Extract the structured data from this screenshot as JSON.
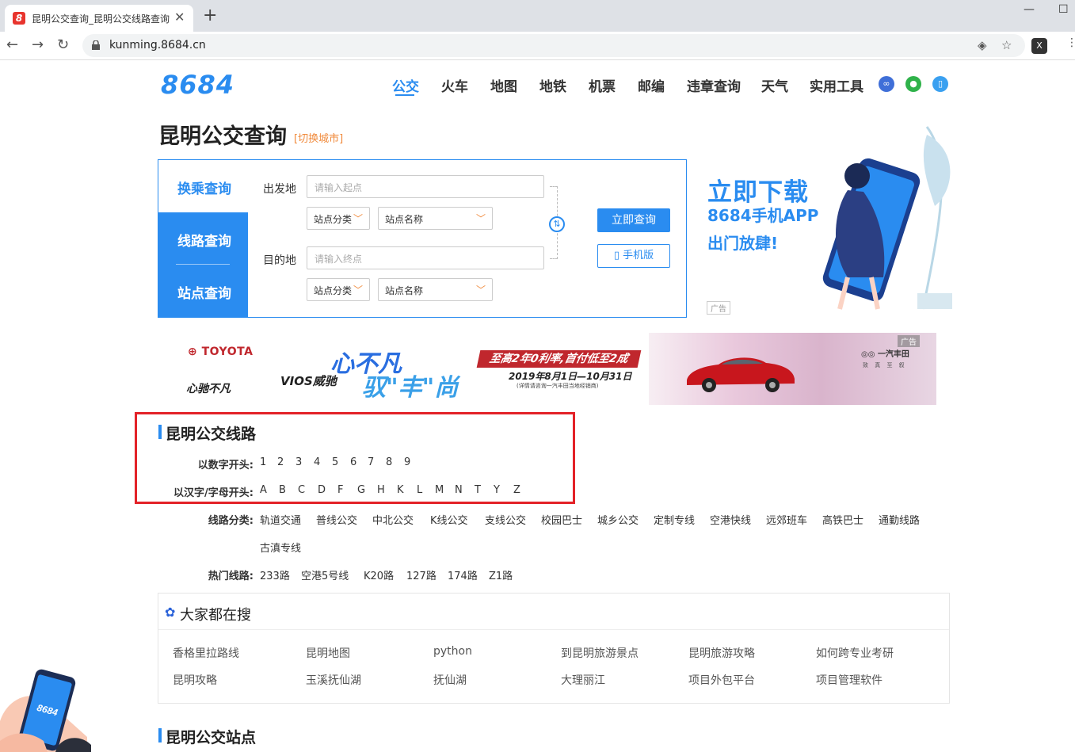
{
  "browser": {
    "tab_title": "昆明公交查询_昆明公交线路查询",
    "tab_favicon": "8",
    "url": "kunming.8684.cn",
    "new_tab": "+",
    "close_tab": "✕"
  },
  "header": {
    "logo": "8684",
    "nav": [
      "公交",
      "火车",
      "地图",
      "地铁",
      "机票",
      "邮编",
      "违章查询",
      "天气",
      "实用工具"
    ],
    "active_nav": "公交",
    "icons": [
      "mini-program-icon",
      "wechat-icon",
      "mobile-icon"
    ]
  },
  "page": {
    "title": "昆明公交查询",
    "switch_city": "[切换城市]"
  },
  "search": {
    "tabs": [
      "换乘查询",
      "线路查询",
      "站点查询"
    ],
    "from_label": "出发地",
    "to_label": "目的地",
    "from_placeholder": "请输入起点",
    "to_placeholder": "请输入终点",
    "station_category": "站点分类",
    "station_name": "站点名称",
    "submit": "立即查询",
    "mobile": "手机版"
  },
  "app_ad": {
    "line1": "立即下载",
    "line2": "8684手机APP",
    "line3": "出门放肆!",
    "ad_tag": "广告"
  },
  "banner": {
    "brand": "TOYOTA",
    "slogan": "心驰不凡",
    "model": "VIOS威驰",
    "big1": "心不凡",
    "big2": "驭\"丰\"尚",
    "offer": "至高2年0利率,首付低至2成",
    "date": "2019年8月1日—10月31日",
    "fine_print": "(详情请咨询一汽丰田当地经销商)",
    "dealer": "一汽丰田",
    "dealer_slogan": "致 真 至 叙",
    "ad_tag": "广告"
  },
  "routes": {
    "title": "昆明公交线路",
    "number_label": "以数字开头:",
    "numbers": [
      "1",
      "2",
      "3",
      "4",
      "5",
      "6",
      "7",
      "8",
      "9"
    ],
    "letter_label": "以汉字/字母开头:",
    "letters": [
      "A",
      "B",
      "C",
      "D",
      "F",
      "G",
      "H",
      "K",
      "L",
      "M",
      "N",
      "T",
      "Y",
      "Z"
    ],
    "category_label": "线路分类:",
    "categories": [
      "轨道交通",
      "普线公交",
      "中北公交",
      "K线公交",
      "支线公交",
      "校园巴士",
      "城乡公交",
      "定制专线",
      "空港快线",
      "远郊班车",
      "高铁巴士",
      "通勤线路",
      "古滇专线"
    ],
    "hot_label": "热门线路:",
    "hot": [
      "233路",
      "空港5号线",
      "K20路",
      "127路",
      "174路",
      "Z1路"
    ]
  },
  "popular": {
    "title": "大家都在搜",
    "row1": [
      "香格里拉路线",
      "昆明地图",
      "python",
      "到昆明旅游景点",
      "昆明旅游攻略",
      "如何跨专业考研"
    ],
    "row2": [
      "昆明攻略",
      "玉溪抚仙湖",
      "抚仙湖",
      "大理丽江",
      "项目外包平台",
      "项目管理软件"
    ]
  },
  "stations": {
    "title": "昆明公交站点"
  },
  "float_phone": {
    "label": "8684"
  },
  "colors": {
    "brand_blue": "#2a8cf0",
    "highlight_red": "#e32228",
    "switch_orange": "#f0893a"
  }
}
